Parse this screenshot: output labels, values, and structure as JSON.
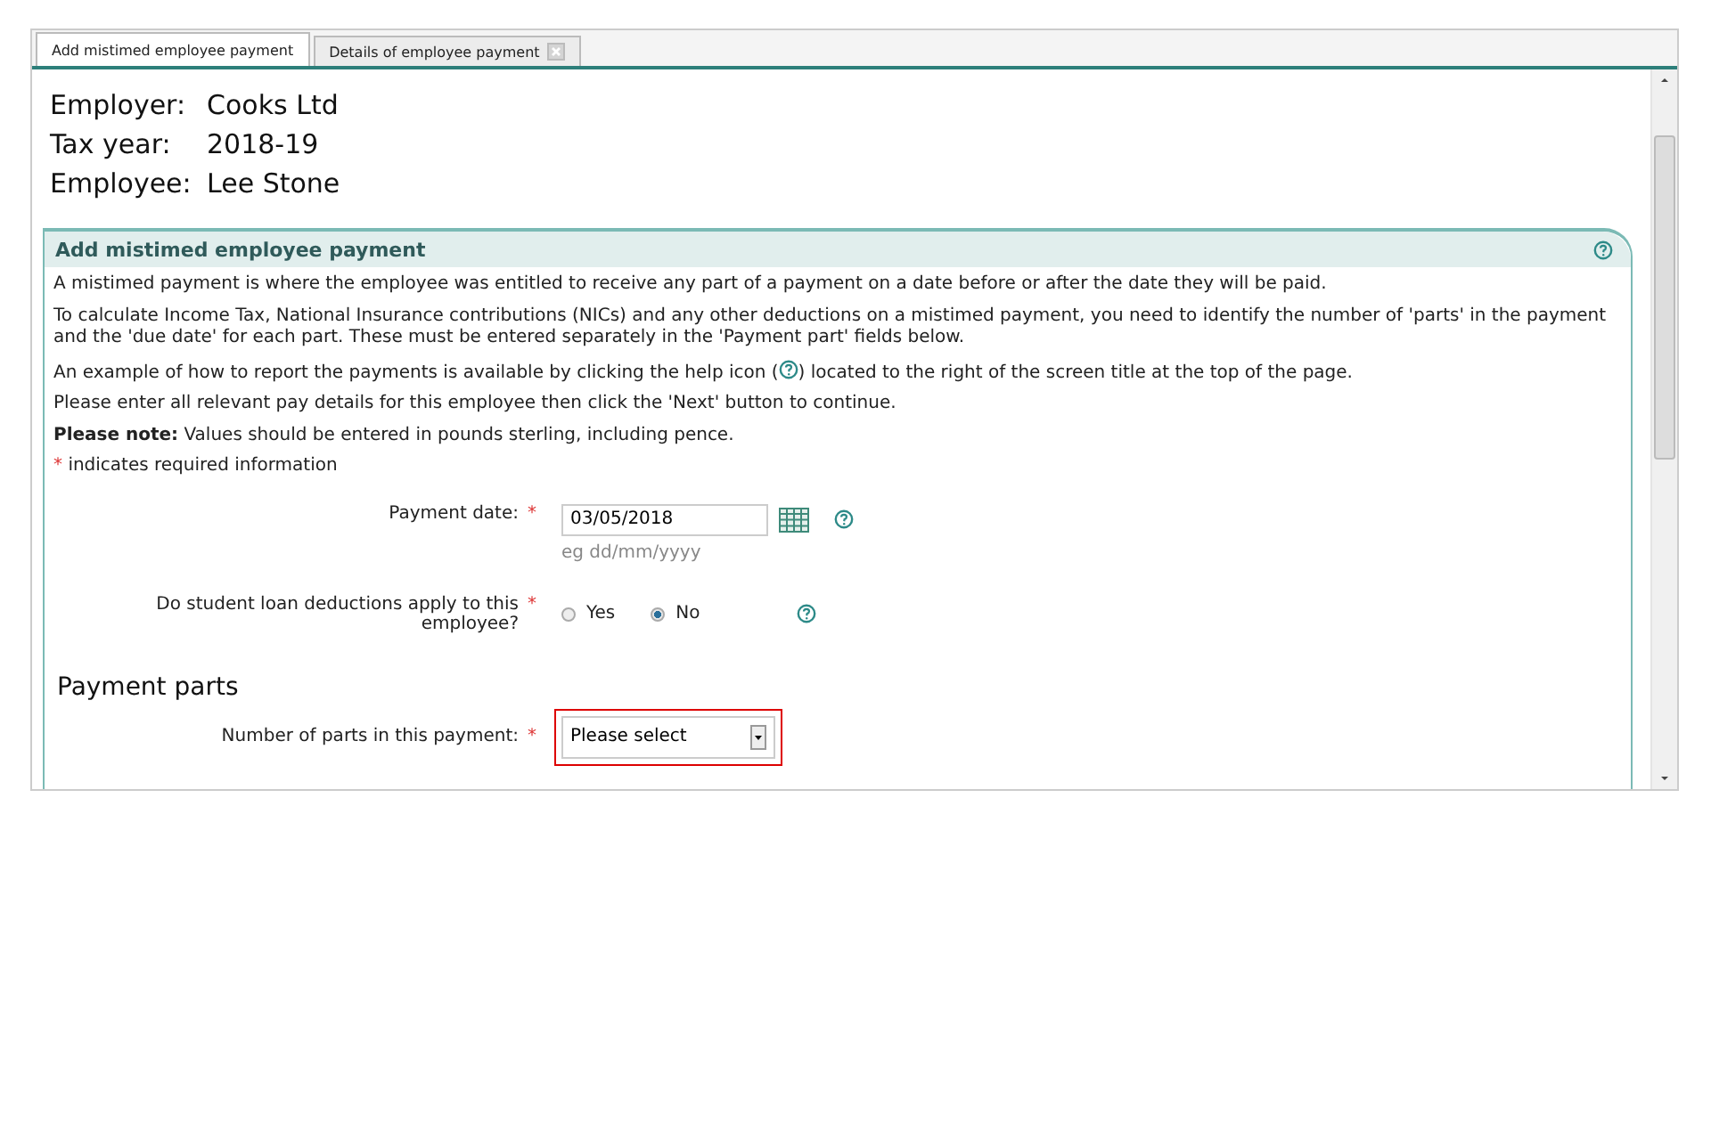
{
  "tabs": [
    {
      "label": "Add mistimed employee payment",
      "selected": true,
      "closable": false
    },
    {
      "label": "Details of employee payment",
      "selected": false,
      "closable": true
    }
  ],
  "summary": [
    {
      "label": "Employer:",
      "value": "Cooks Ltd"
    },
    {
      "label": "Tax year:",
      "value": "2018-19"
    },
    {
      "label": "Employee:",
      "value": "Lee Stone"
    }
  ],
  "section": {
    "title": "Add mistimed employee payment",
    "paragraphs": [
      {
        "text": "A mistimed payment is where the employee was entitled to receive any part of a payment on a date before or after the date they will be paid."
      },
      {
        "text": "To calculate Income Tax, National Insurance contributions (NICs) and any other deductions on a mistimed payment, you need to identify the number of 'parts' in the payment and the 'due date' for each part. These must be entered separately in the 'Payment part' fields below."
      },
      {
        "text": "An example of how to report the payments is available by clicking the help icon (",
        "text_after": ") located to the right of the screen title at the top of the page."
      },
      {
        "text": "Please enter all relevant pay details for this employee then click the 'Next' button to continue."
      },
      {
        "text": "**Please note:** Values should be entered in pounds sterling, including pence."
      }
    ],
    "required_note": {
      "marker": "*",
      "text": "indicates required information"
    },
    "payment_date": {
      "label": "Payment date:",
      "required_marker": "*",
      "value": "03/05/2018",
      "hint": "eg dd/mm/yyyy"
    },
    "student_loan": {
      "label": "Do student loan deductions apply to this employee?",
      "required_marker": "*",
      "options": [
        {
          "label": "Yes",
          "selected": false
        },
        {
          "label": "No",
          "selected": true
        }
      ]
    },
    "payment_parts": {
      "heading": "Payment parts",
      "label": "Number of parts in this payment:",
      "required_marker": "*",
      "value": "Please select",
      "focused": true
    }
  }
}
